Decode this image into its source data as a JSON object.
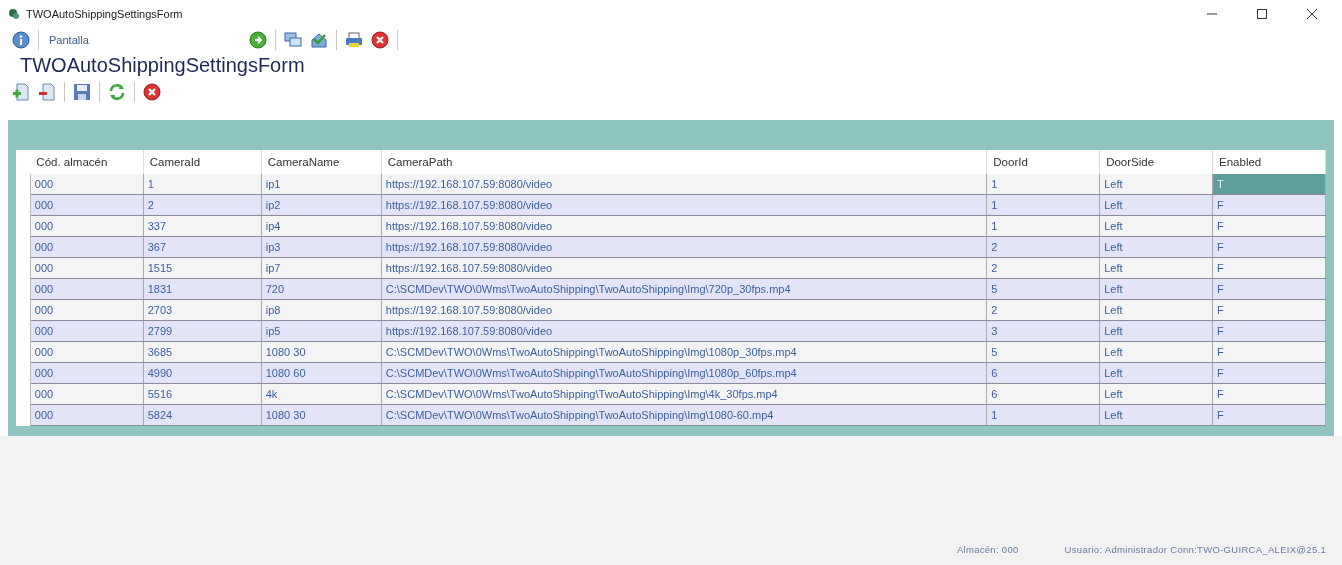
{
  "window": {
    "title": "TWOAutoShippingSettingsForm"
  },
  "toolbar": {
    "screen_field": {
      "value": "Pantalla"
    }
  },
  "form_title": "TWOAutoShippingSettingsForm",
  "table": {
    "columns": [
      "Cód. almacén",
      "CameraId",
      "CameraName",
      "CameraPath",
      "DoorId",
      "DoorSide",
      "Enabled"
    ],
    "rows": [
      {
        "cells": [
          {
            "text": "000",
            "selected": false
          },
          {
            "text": "1",
            "selected": false
          },
          {
            "text": "ip1",
            "selected": false
          },
          {
            "text": "https://192.168.107.59:8080/video",
            "selected": false
          },
          {
            "text": "1",
            "selected": false
          },
          {
            "text": "Left",
            "selected": false
          },
          {
            "text": "T",
            "selected": true
          }
        ]
      },
      {
        "cells": [
          {
            "text": "000",
            "selected": false
          },
          {
            "text": "2",
            "selected": false
          },
          {
            "text": "ip2",
            "selected": false
          },
          {
            "text": "https://192.168.107.59:8080/video",
            "selected": false
          },
          {
            "text": "1",
            "selected": false
          },
          {
            "text": "Left",
            "selected": false
          },
          {
            "text": "F",
            "selected": false
          }
        ]
      },
      {
        "cells": [
          {
            "text": "000",
            "selected": false
          },
          {
            "text": "337",
            "selected": false
          },
          {
            "text": "ip4",
            "selected": false
          },
          {
            "text": "https://192.168.107.59:8080/video",
            "selected": false
          },
          {
            "text": "1",
            "selected": false
          },
          {
            "text": "Left",
            "selected": false
          },
          {
            "text": "F",
            "selected": false
          }
        ]
      },
      {
        "cells": [
          {
            "text": "000",
            "selected": false
          },
          {
            "text": "367",
            "selected": false
          },
          {
            "text": "ip3",
            "selected": false
          },
          {
            "text": "https://192.168.107.59:8080/video",
            "selected": false
          },
          {
            "text": "2",
            "selected": false
          },
          {
            "text": "Left",
            "selected": false
          },
          {
            "text": "F",
            "selected": false
          }
        ]
      },
      {
        "cells": [
          {
            "text": "000",
            "selected": false
          },
          {
            "text": "1515",
            "selected": false
          },
          {
            "text": "ip7",
            "selected": false
          },
          {
            "text": "https://192.168.107.59:8080/video",
            "selected": false
          },
          {
            "text": "2",
            "selected": false
          },
          {
            "text": "Left",
            "selected": false
          },
          {
            "text": "F",
            "selected": false
          }
        ]
      },
      {
        "cells": [
          {
            "text": "000",
            "selected": false
          },
          {
            "text": "1831",
            "selected": false
          },
          {
            "text": "720",
            "selected": false
          },
          {
            "text": "C:\\SCMDev\\TWO\\0Wms\\TwoAutoShipping\\TwoAutoShipping\\Img\\720p_30fps.mp4",
            "selected": false
          },
          {
            "text": "5",
            "selected": false
          },
          {
            "text": "Left",
            "selected": false
          },
          {
            "text": "F",
            "selected": false
          }
        ]
      },
      {
        "cells": [
          {
            "text": "000",
            "selected": false
          },
          {
            "text": "2703",
            "selected": false
          },
          {
            "text": "ip8",
            "selected": false
          },
          {
            "text": "https://192.168.107.59:8080/video",
            "selected": false
          },
          {
            "text": "2",
            "selected": false
          },
          {
            "text": "Left",
            "selected": false
          },
          {
            "text": "F",
            "selected": false
          }
        ]
      },
      {
        "cells": [
          {
            "text": "000",
            "selected": false
          },
          {
            "text": "2799",
            "selected": false
          },
          {
            "text": "ip5",
            "selected": false
          },
          {
            "text": "https://192.168.107.59:8080/video",
            "selected": false
          },
          {
            "text": "3",
            "selected": false
          },
          {
            "text": "Left",
            "selected": false
          },
          {
            "text": "F",
            "selected": false
          }
        ]
      },
      {
        "cells": [
          {
            "text": "000",
            "selected": false
          },
          {
            "text": "3685",
            "selected": false
          },
          {
            "text": "1080 30",
            "selected": false
          },
          {
            "text": "C:\\SCMDev\\TWO\\0Wms\\TwoAutoShipping\\TwoAutoShipping\\Img\\1080p_30fps.mp4",
            "selected": false
          },
          {
            "text": "5",
            "selected": false
          },
          {
            "text": "Left",
            "selected": false
          },
          {
            "text": "F",
            "selected": false
          }
        ]
      },
      {
        "cells": [
          {
            "text": "000",
            "selected": false
          },
          {
            "text": "4990",
            "selected": false
          },
          {
            "text": "1080 60",
            "selected": false
          },
          {
            "text": "C:\\SCMDev\\TWO\\0Wms\\TwoAutoShipping\\TwoAutoShipping\\Img\\1080p_60fps.mp4",
            "selected": false
          },
          {
            "text": "6",
            "selected": false
          },
          {
            "text": "Left",
            "selected": false
          },
          {
            "text": "F",
            "selected": false
          }
        ]
      },
      {
        "cells": [
          {
            "text": "000",
            "selected": false
          },
          {
            "text": "5516",
            "selected": false
          },
          {
            "text": "4k",
            "selected": false
          },
          {
            "text": "C:\\SCMDev\\TWO\\0Wms\\TwoAutoShipping\\TwoAutoShipping\\Img\\4k_30fps.mp4",
            "selected": false
          },
          {
            "text": "6",
            "selected": false
          },
          {
            "text": "Left",
            "selected": false
          },
          {
            "text": "F",
            "selected": false
          }
        ]
      },
      {
        "cells": [
          {
            "text": "000",
            "selected": false
          },
          {
            "text": "5824",
            "selected": false
          },
          {
            "text": "1080 30",
            "selected": false
          },
          {
            "text": "C:\\SCMDev\\TWO\\0Wms\\TwoAutoShipping\\TwoAutoShipping\\Img\\1080-60.mp4",
            "selected": false
          },
          {
            "text": "1",
            "selected": false
          },
          {
            "text": "Left",
            "selected": false
          },
          {
            "text": "F",
            "selected": false
          }
        ]
      }
    ]
  },
  "status_bar": {
    "warehouse": "Almacén: 000",
    "user": "Usuario: Administrador Conn:TWO-GUIRCA_ALEIX@25.1"
  }
}
